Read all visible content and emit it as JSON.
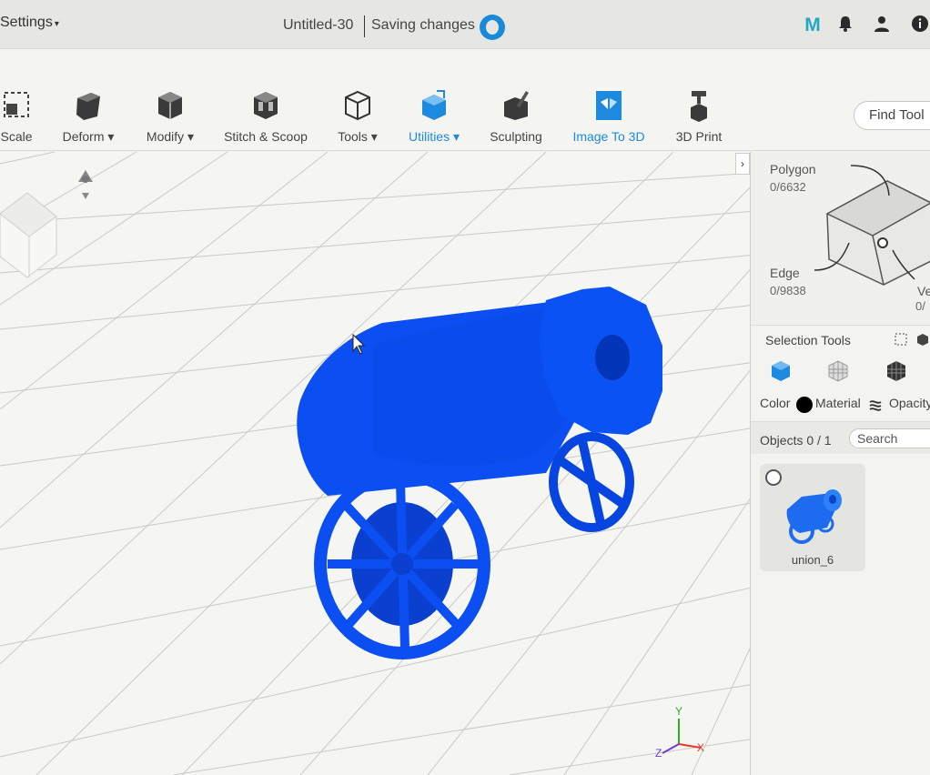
{
  "header": {
    "settings_label": "Settings",
    "doc_title": "Untitled-30",
    "status": "Saving changes",
    "icons": [
      "m-logo",
      "bell-icon",
      "user-icon",
      "info-icon"
    ],
    "logo_letter": "M"
  },
  "toolbar": {
    "items": [
      {
        "label": "Scale",
        "icon": "scale-icon"
      },
      {
        "label": "Deform",
        "icon": "deform-icon",
        "dropdown": true
      },
      {
        "label": "Modify",
        "icon": "modify-icon",
        "dropdown": true
      },
      {
        "label": "Stitch & Scoop",
        "icon": "stitch-scoop-icon"
      },
      {
        "label": "Tools",
        "icon": "tools-icon",
        "dropdown": true
      },
      {
        "label": "Utilities",
        "icon": "utilities-icon",
        "dropdown": true,
        "active": true
      },
      {
        "label": "Sculpting",
        "icon": "sculpting-icon"
      },
      {
        "label": "Image To 3D",
        "icon": "image-to-3d-icon",
        "active": true
      },
      {
        "label": "3D Print",
        "icon": "3d-print-icon"
      }
    ],
    "find_tool": "Find Tool"
  },
  "panel": {
    "polygon_label": "Polygon",
    "polygon_count": "0/6632",
    "edge_label": "Edge",
    "edge_count": "0/9838",
    "vertex_label": "Ve",
    "vertex_count": "0/",
    "selection_tools": "Selection Tools",
    "props": {
      "color": "Color",
      "material": "Material",
      "opacity": "Opacity"
    },
    "objects_label": "Objects 0 / 1",
    "search_placeholder": "Search",
    "object_name": "union_6"
  },
  "colors": {
    "accent": "#1d8ae0",
    "model": "#0b4ff2",
    "header": "#e6e6e2"
  }
}
